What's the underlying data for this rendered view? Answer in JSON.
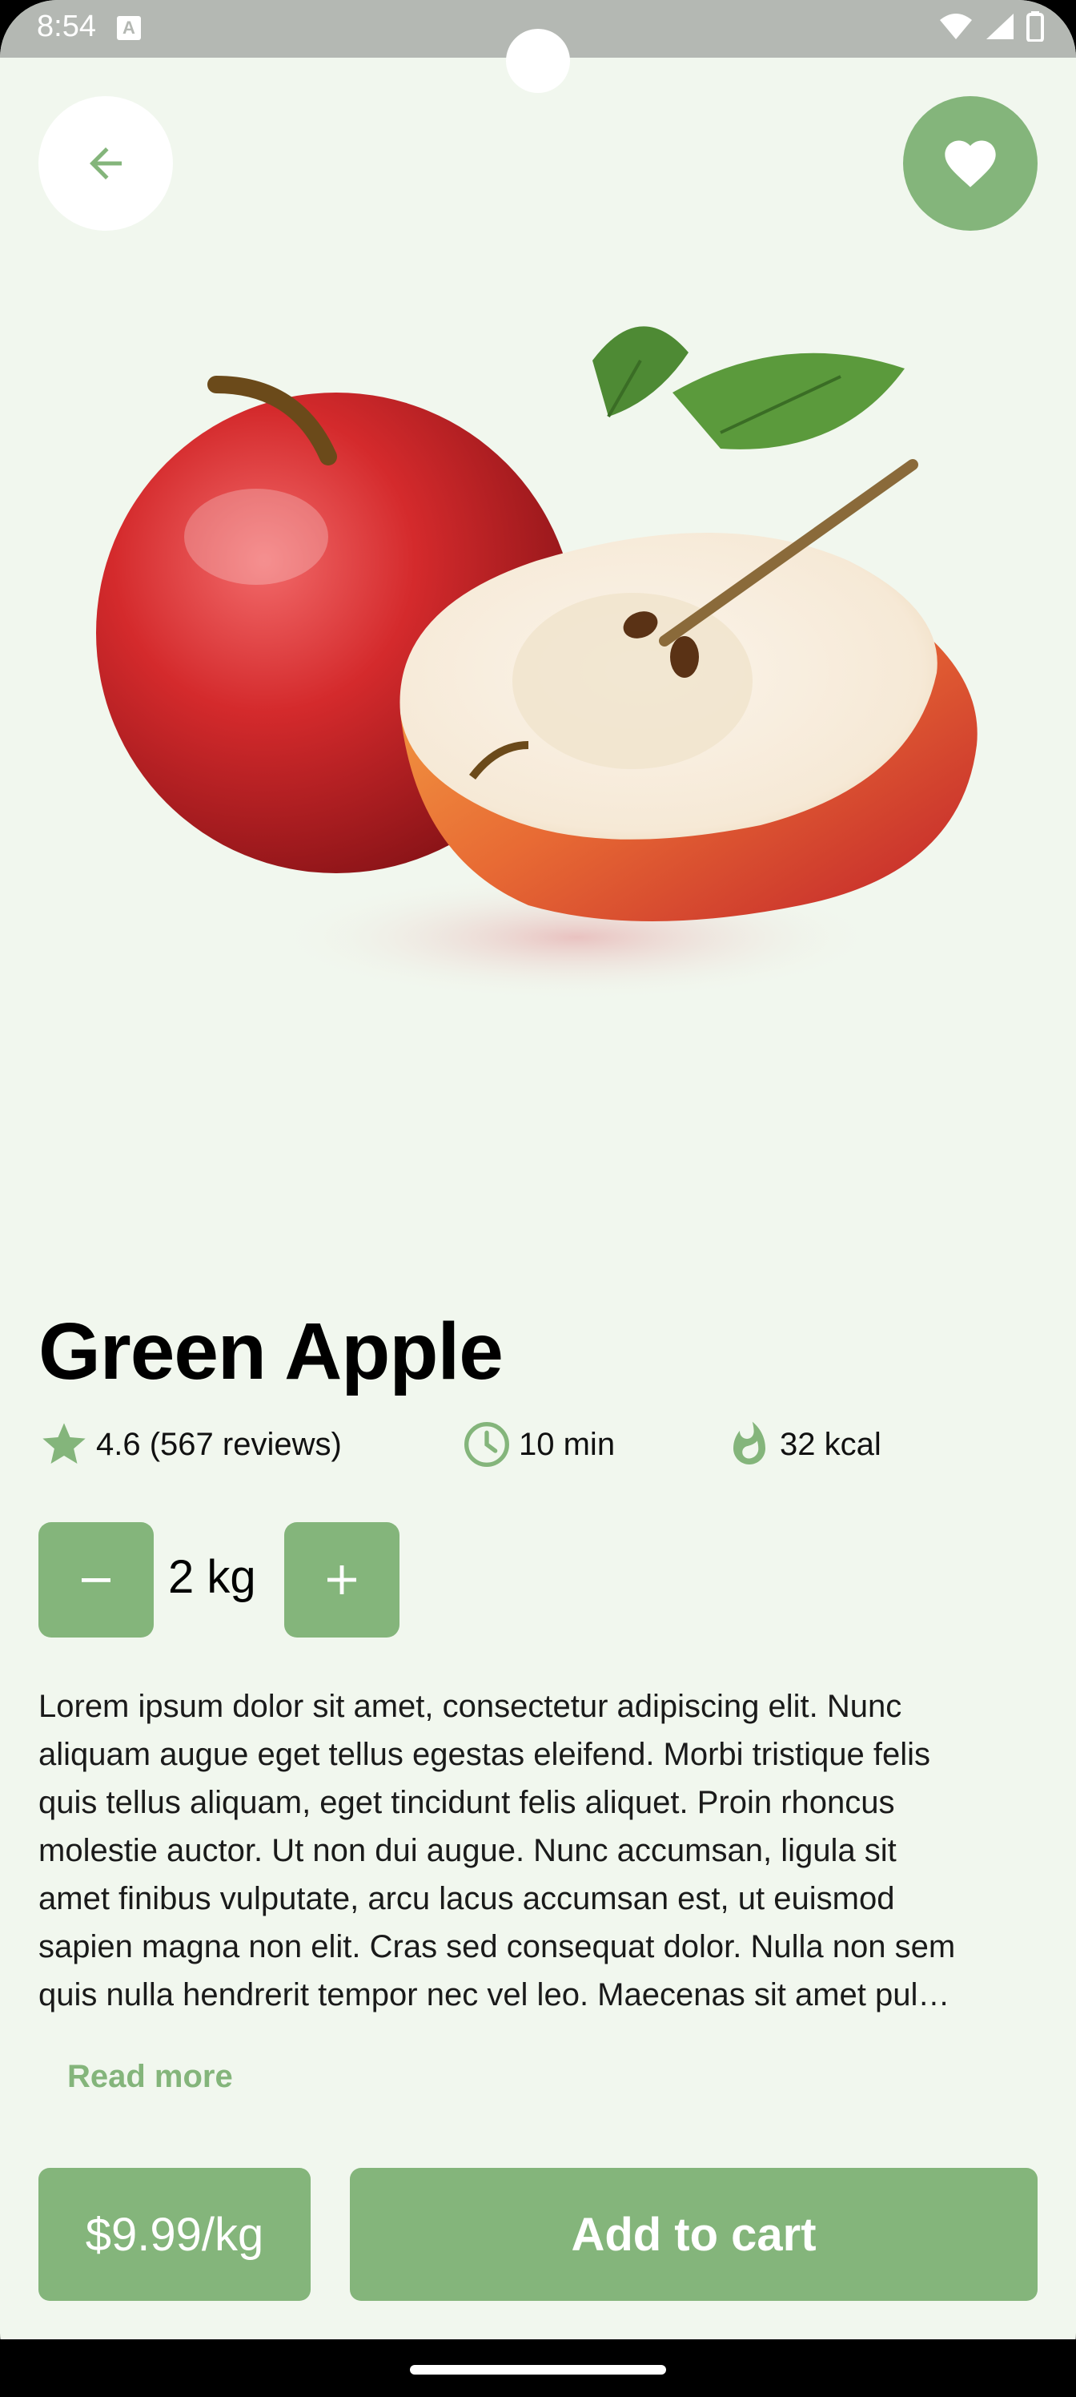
{
  "status_bar": {
    "time": "8:54",
    "a_badge": "A",
    "icons": [
      "wifi-icon",
      "signal-icon",
      "battery-icon"
    ]
  },
  "header": {
    "back_icon": "arrow-left-icon",
    "favorite_icon": "heart-icon"
  },
  "product": {
    "image": "apple-photo",
    "name": "Green Apple",
    "rating": "4.6 (567 reviews)",
    "time": "10 min",
    "calories": "32 kcal",
    "quantity": "2 kg",
    "description_lines": [
      "Lorem ipsum dolor sit amet, consectetur adipiscing elit. Nunc",
      "aliquam augue eget tellus egestas eleifend. Morbi tristique felis",
      "quis tellus aliquam, eget tincidunt felis aliquet. Proin rhoncus",
      "molestie auctor. Ut non dui augue. Nunc accumsan, ligula sit",
      "amet finibus vulputate, arcu lacus accumsan est, ut euismod",
      "sapien magna non elit. Cras sed consequat dolor. Nulla non sem",
      "quis nulla hendrerit tempor nec vel leo. Maecenas sit amet pul…"
    ],
    "read_more": "Read more",
    "price": "$9.99/kg",
    "add_to_cart": "Add to cart"
  },
  "colors": {
    "accent": "#84b57b",
    "background": "#f1f7ee",
    "status_bar": "#b4b8b3"
  }
}
